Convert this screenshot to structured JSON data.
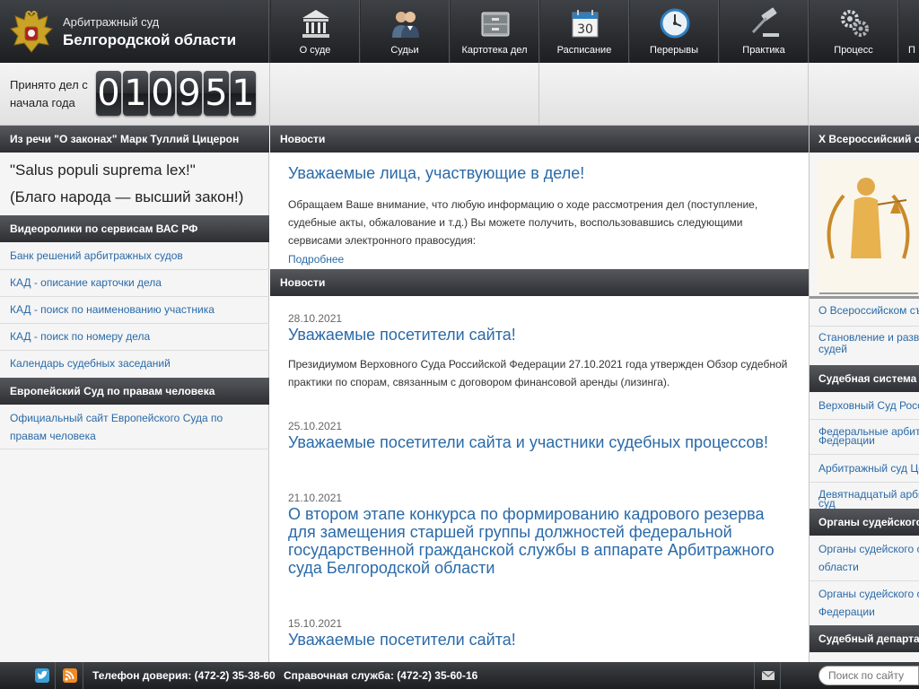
{
  "header": {
    "brand_line1": "Арбитражный суд",
    "brand_line2": "Белгородской области",
    "nav": [
      {
        "label": "О суде",
        "icon": "courthouse-icon"
      },
      {
        "label": "Судьи",
        "icon": "judges-icon"
      },
      {
        "label": "Картотека дел",
        "icon": "file-cabinet-icon"
      },
      {
        "label": "Расписание",
        "icon": "calendar-icon",
        "icon_text": "30"
      },
      {
        "label": "Перерывы",
        "icon": "clock-icon"
      },
      {
        "label": "Практика",
        "icon": "gavel-icon"
      },
      {
        "label": "Процесс",
        "icon": "gears-icon"
      },
      {
        "label": "П",
        "icon": "more-icon"
      }
    ]
  },
  "counter": {
    "label": "Принято дел с начала года",
    "digits": [
      "0",
      "1",
      "0",
      "9",
      "5",
      "1"
    ]
  },
  "left": {
    "quote_head": "Из речи \"О законах\" Марк Туллий Цицерон",
    "quote_latin": "\"Salus populi suprema lex!\"",
    "quote_ru": "(Благо народа — высший закон!)",
    "video_head": "Видеоролики по сервисам ВАС РФ",
    "video_links": [
      "Банк решений арбитражных судов",
      "КАД - описание карточки дела",
      "КАД - поиск по наименованию участника",
      "КАД - поиск по номеру дела",
      "Календарь судебных заседаний"
    ],
    "echr_head": "Европейский Суд по правам человека",
    "echr_link": "Официальный сайт Европейского Суда по правам человека"
  },
  "center": {
    "head1": "Новости",
    "featured_title": "Уважаемые лица, участвующие в деле!",
    "featured_body": "Обращаем Ваше внимание, что любую информацию о ходе рассмотрения дел (поступление, судебные акты, обжалование и т.д.) Вы можете получить, воспользовавшись следующими сервисами электронного правосудия:",
    "more": "Подробнее",
    "head2": "Новости",
    "news": [
      {
        "date": "28.10.2021",
        "title": "Уважаемые посетители сайта!",
        "body": "Президиумом Верховного Суда Российской Федерации 27.10.2021 года утвержден Обзор судебной практики по спорам, связанным с договором финансовой аренды (лизинга)."
      },
      {
        "date": "25.10.2021",
        "title": "Уважаемые посетители сайта и участники судебных процессов!"
      },
      {
        "date": "21.10.2021",
        "title": "О втором этапе конкурса по формированию кадрового резерва для замещения старшей группы должностей федеральной государственной гражданской службы в аппарате Арбитражного суда Белгородской области"
      },
      {
        "date": "15.10.2021",
        "title": "Уважаемые посетители сайта!"
      }
    ]
  },
  "right": {
    "head1": "X Всероссийский с",
    "links1": [
      "О Всероссийском съ",
      "Становление и разв",
      "судей"
    ],
    "head2": "Судебная система",
    "links2": [
      "Верховный Суд Росс",
      "Федеральные арбит",
      "Федерации",
      "Арбитражный суд Це",
      "Девятнадцатый арби",
      "суд"
    ],
    "head3": "Органы судейского",
    "links3": [
      "Органы судейского с",
      "области",
      "Органы судейского с",
      "Федерации"
    ],
    "head4": "Судебный департа"
  },
  "footer": {
    "hotline": "Телефон доверия: (472-2) 35-38-60",
    "info": "Справочная служба: (472-2) 35-60-16",
    "search_placeholder": "Поиск по сайту"
  }
}
